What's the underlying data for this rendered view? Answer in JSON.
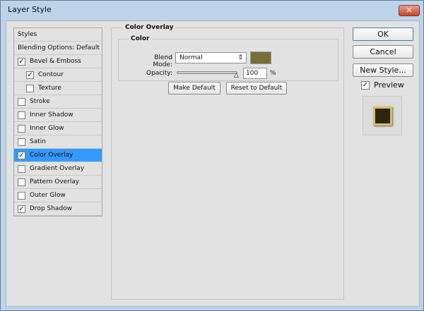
{
  "window": {
    "title": "Layer Style",
    "close_glyph": "✕"
  },
  "styles_list": [
    {
      "label": "Styles",
      "checkbox": false,
      "checked": false,
      "indent": false,
      "selected": false
    },
    {
      "label": "Blending Options: Default",
      "checkbox": false,
      "checked": false,
      "indent": false,
      "selected": false
    },
    {
      "label": "Bevel & Emboss",
      "checkbox": true,
      "checked": true,
      "indent": false,
      "selected": false
    },
    {
      "label": "Contour",
      "checkbox": true,
      "checked": true,
      "indent": true,
      "selected": false
    },
    {
      "label": "Texture",
      "checkbox": true,
      "checked": false,
      "indent": true,
      "selected": false
    },
    {
      "label": "Stroke",
      "checkbox": true,
      "checked": false,
      "indent": false,
      "selected": false
    },
    {
      "label": "Inner Shadow",
      "checkbox": true,
      "checked": false,
      "indent": false,
      "selected": false
    },
    {
      "label": "Inner Glow",
      "checkbox": true,
      "checked": false,
      "indent": false,
      "selected": false
    },
    {
      "label": "Satin",
      "checkbox": true,
      "checked": false,
      "indent": false,
      "selected": false
    },
    {
      "label": "Color Overlay",
      "checkbox": true,
      "checked": true,
      "indent": false,
      "selected": true
    },
    {
      "label": "Gradient Overlay",
      "checkbox": true,
      "checked": false,
      "indent": false,
      "selected": false
    },
    {
      "label": "Pattern Overlay",
      "checkbox": true,
      "checked": false,
      "indent": false,
      "selected": false
    },
    {
      "label": "Outer Glow",
      "checkbox": true,
      "checked": false,
      "indent": false,
      "selected": false
    },
    {
      "label": "Drop Shadow",
      "checkbox": true,
      "checked": true,
      "indent": false,
      "selected": false
    }
  ],
  "panel": {
    "title": "Color Overlay",
    "group": "Color",
    "blend_mode_label": "Blend Mode:",
    "blend_mode_value": "Normal",
    "blend_mode_arrow": "⇕",
    "overlay_color": "#7a6d3a",
    "opacity_label": "Opacity:",
    "opacity_value": "100",
    "opacity_unit": "%",
    "opacity_percent": 100,
    "make_default": "Make Default",
    "reset_default": "Reset to Default"
  },
  "actions": {
    "ok": "OK",
    "cancel": "Cancel",
    "new_style": "New Style...",
    "preview_label": "Preview",
    "preview_checked": true
  }
}
